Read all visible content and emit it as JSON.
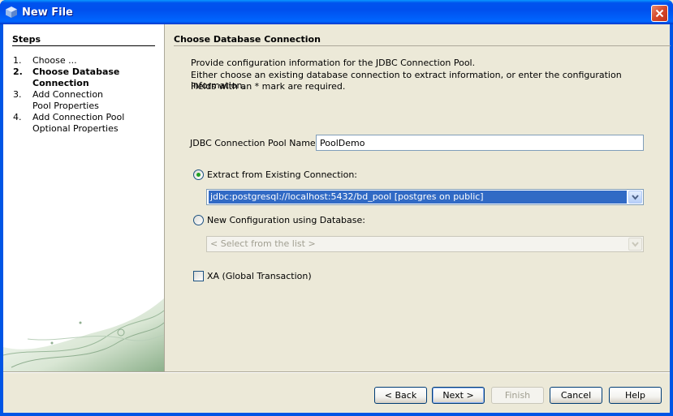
{
  "window": {
    "title": "New File"
  },
  "steps": {
    "heading": "Steps",
    "items": [
      {
        "num": "1.",
        "label": "Choose ...",
        "current": false
      },
      {
        "num": "2.",
        "label": "Choose Database Connection",
        "current": true
      },
      {
        "num": "3.",
        "label": "Add Connection Pool Properties",
        "current": false
      },
      {
        "num": "4.",
        "label": "Add Connection Pool Optional Properties",
        "current": false
      }
    ]
  },
  "content": {
    "title": "Choose Database Connection",
    "description": [
      "Provide configuration information for the JDBC Connection Pool.",
      "Either choose an existing database connection to extract information, or enter the configuration information.",
      "Fields with an * mark are required."
    ],
    "pool_name_label": "JDBC Connection Pool Name:*",
    "pool_name_value": "PoolDemo",
    "extract_radio_label": "Extract from Existing Connection:",
    "extract_radio_checked": true,
    "existing_connection_value": "jdbc:postgresql://localhost:5432/bd_pool [postgres on public]",
    "new_config_radio_label": "New Configuration using Database:",
    "new_config_radio_checked": false,
    "database_select_placeholder": "< Select from the list >",
    "xa_checkbox_label": "XA (Global Transaction)",
    "xa_checked": false
  },
  "buttons": {
    "back": "< Back",
    "next": "Next >",
    "finish": "Finish",
    "cancel": "Cancel",
    "help": "Help"
  },
  "colors": {
    "titlebar": "#0053EE",
    "selection": "#316AC5",
    "radio_dot": "#21A121"
  }
}
